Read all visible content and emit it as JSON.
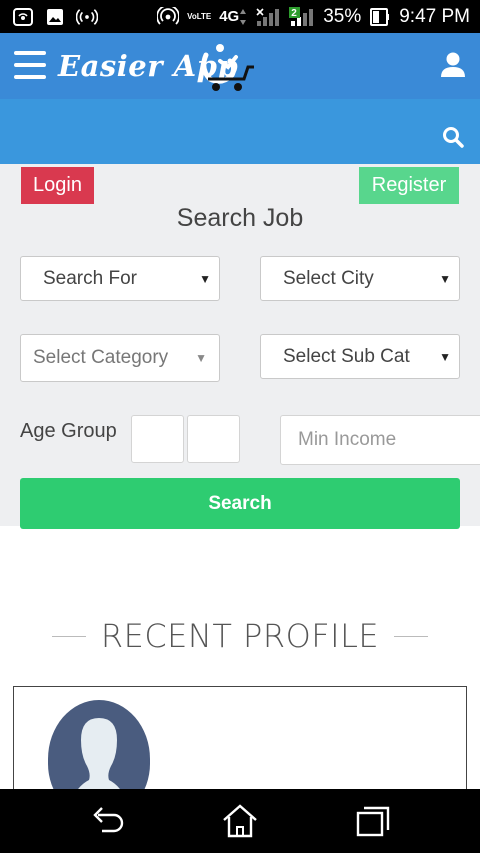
{
  "status_bar": {
    "battery": "35%",
    "time": "9:47 PM",
    "network_label": "4G",
    "volte_label": "VoLTE",
    "sim_badge": "2",
    "icons": [
      "hotspot-icon",
      "image-icon",
      "radio-waves-icon",
      "wifi-calling-icon",
      "volte-icon",
      "4g-icon",
      "signal-icon",
      "signal-2-icon",
      "battery-icon"
    ]
  },
  "header": {
    "logo_text": "Easier App",
    "menu_icon": "hamburger-menu-icon",
    "user_icon": "user-icon",
    "brand_color": "#3a8ad7"
  },
  "search_bar": {
    "icon": "search-icon",
    "color": "#3a97dd"
  },
  "auth": {
    "login_label": "Login",
    "register_label": "Register",
    "login_color": "#d9394f",
    "register_color": "#58d68d"
  },
  "form": {
    "title": "Search Job",
    "search_for": "Search For",
    "select_city": "Select City",
    "select_category": "Select Category",
    "select_sub_cat": "Select Sub Cat",
    "age_group_label": "Age Group",
    "age_min_value": "",
    "age_max_value": "",
    "min_income_placeholder": "Min Income",
    "search_button_label": "Search",
    "search_button_color": "#2ecc71"
  },
  "recent": {
    "heading": "RECENT PROFILE"
  },
  "nav": {
    "icons": [
      "back-icon",
      "home-icon",
      "recent-apps-icon"
    ]
  }
}
